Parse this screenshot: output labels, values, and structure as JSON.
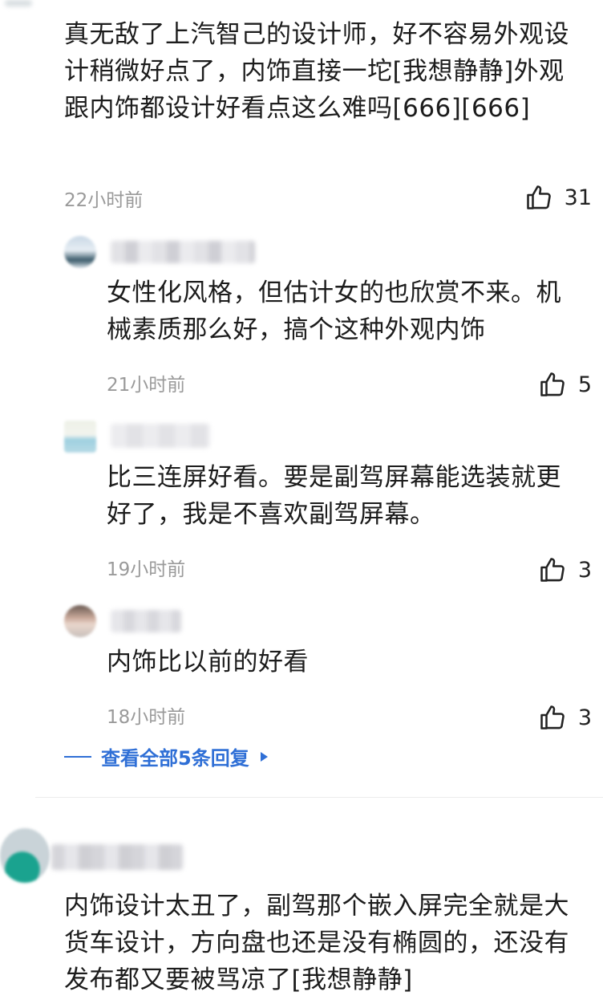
{
  "comments": [
    {
      "text": "真无敌了上汽智己的设计师，好不容易外观设计稍微好点了，内饰直接一坨[我想静静]外观跟内饰都设计好看点这么难吗[666][666]",
      "time": "22小时前",
      "likes": "31"
    }
  ],
  "replies": [
    {
      "text": "女性化风格，但估计女的也欣赏不来。机械素质那么好，搞个这种外观内饰",
      "time": "21小时前",
      "likes": "5"
    },
    {
      "text": "比三连屏好看。要是副驾屏幕能选装就更好了，我是不喜欢副驾屏幕。",
      "time": "19小时前",
      "likes": "3"
    },
    {
      "text": "内饰比以前的好看",
      "time": "18小时前",
      "likes": "3"
    }
  ],
  "view_all": "查看全部5条回复",
  "second_comment": {
    "text": "内饰设计太丑了，副驾那个嵌入屏完全就是大货车设计，方向盘也还是没有椭圆的，还没有发布都又要被骂凉了[我想静静]"
  },
  "colors": {
    "accent": "#2f6fd6",
    "time": "#9a9a9a",
    "text": "#1c1c1c"
  }
}
